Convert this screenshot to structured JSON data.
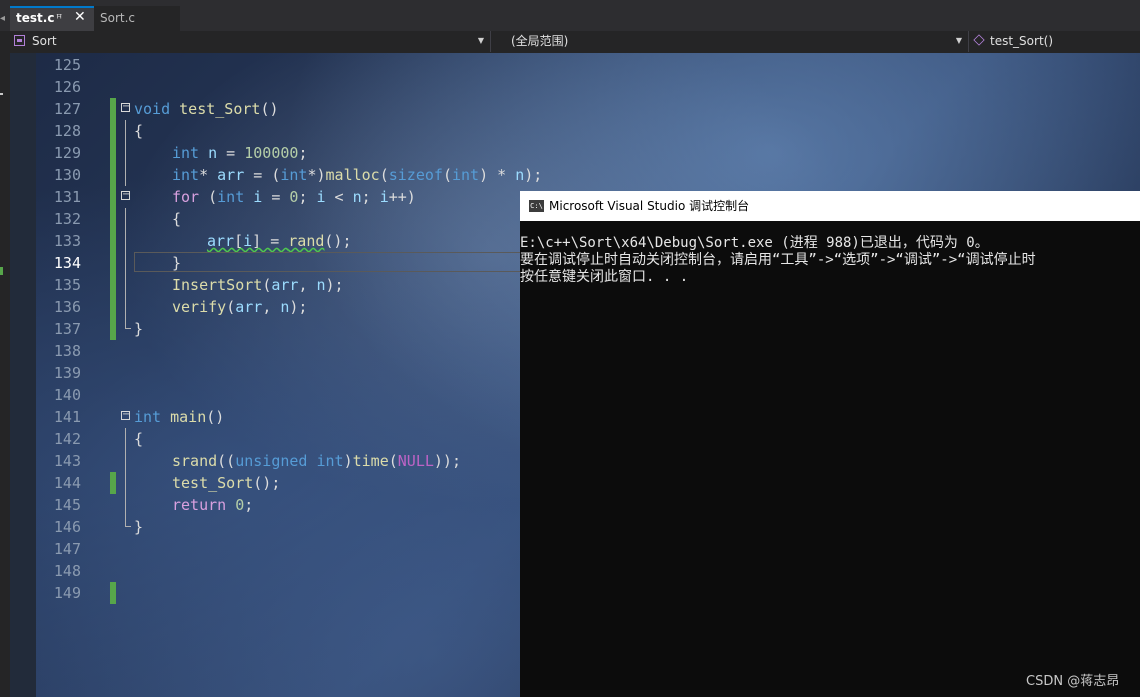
{
  "tabs": {
    "active_label": "test.c",
    "pin_glyph": "ꟸ",
    "close_glyph": "✕",
    "inactive_label": "Sort.c"
  },
  "navbar": {
    "project": "Sort",
    "scope": "(全局范围)",
    "function": "test_Sort()"
  },
  "code": {
    "active_line": 134,
    "lines": [
      {
        "n": "125"
      },
      {
        "n": "126"
      },
      {
        "n": "127"
      },
      {
        "n": "128"
      },
      {
        "n": "129"
      },
      {
        "n": "130"
      },
      {
        "n": "131"
      },
      {
        "n": "132"
      },
      {
        "n": "133"
      },
      {
        "n": "134"
      },
      {
        "n": "135"
      },
      {
        "n": "136"
      },
      {
        "n": "137"
      },
      {
        "n": "138"
      },
      {
        "n": "139"
      },
      {
        "n": "140"
      },
      {
        "n": "141"
      },
      {
        "n": "142"
      },
      {
        "n": "143"
      },
      {
        "n": "144"
      },
      {
        "n": "145"
      },
      {
        "n": "146"
      },
      {
        "n": "147"
      },
      {
        "n": "148"
      },
      {
        "n": "149"
      }
    ]
  },
  "console": {
    "title": "Microsoft Visual Studio 调试控制台",
    "icon_text": "C:\\",
    "lines": [
      "E:\\c++\\Sort\\x64\\Debug\\Sort.exe (进程 988)已退出，代码为 0。",
      "要在调试停止时自动关闭控制台，请启用“工具”->“选项”->“调试”->“调试停止时",
      "按任意键关闭此窗口. . ."
    ]
  },
  "watermark": "CSDN @蒋志昂",
  "colors": {
    "accent": "#007acc",
    "change_marker": "#57a64a",
    "keyword": "#569cd6",
    "function": "#dcdcaa",
    "variable": "#9cdcfe",
    "number": "#b5cea8",
    "macro": "#bd63c5"
  }
}
